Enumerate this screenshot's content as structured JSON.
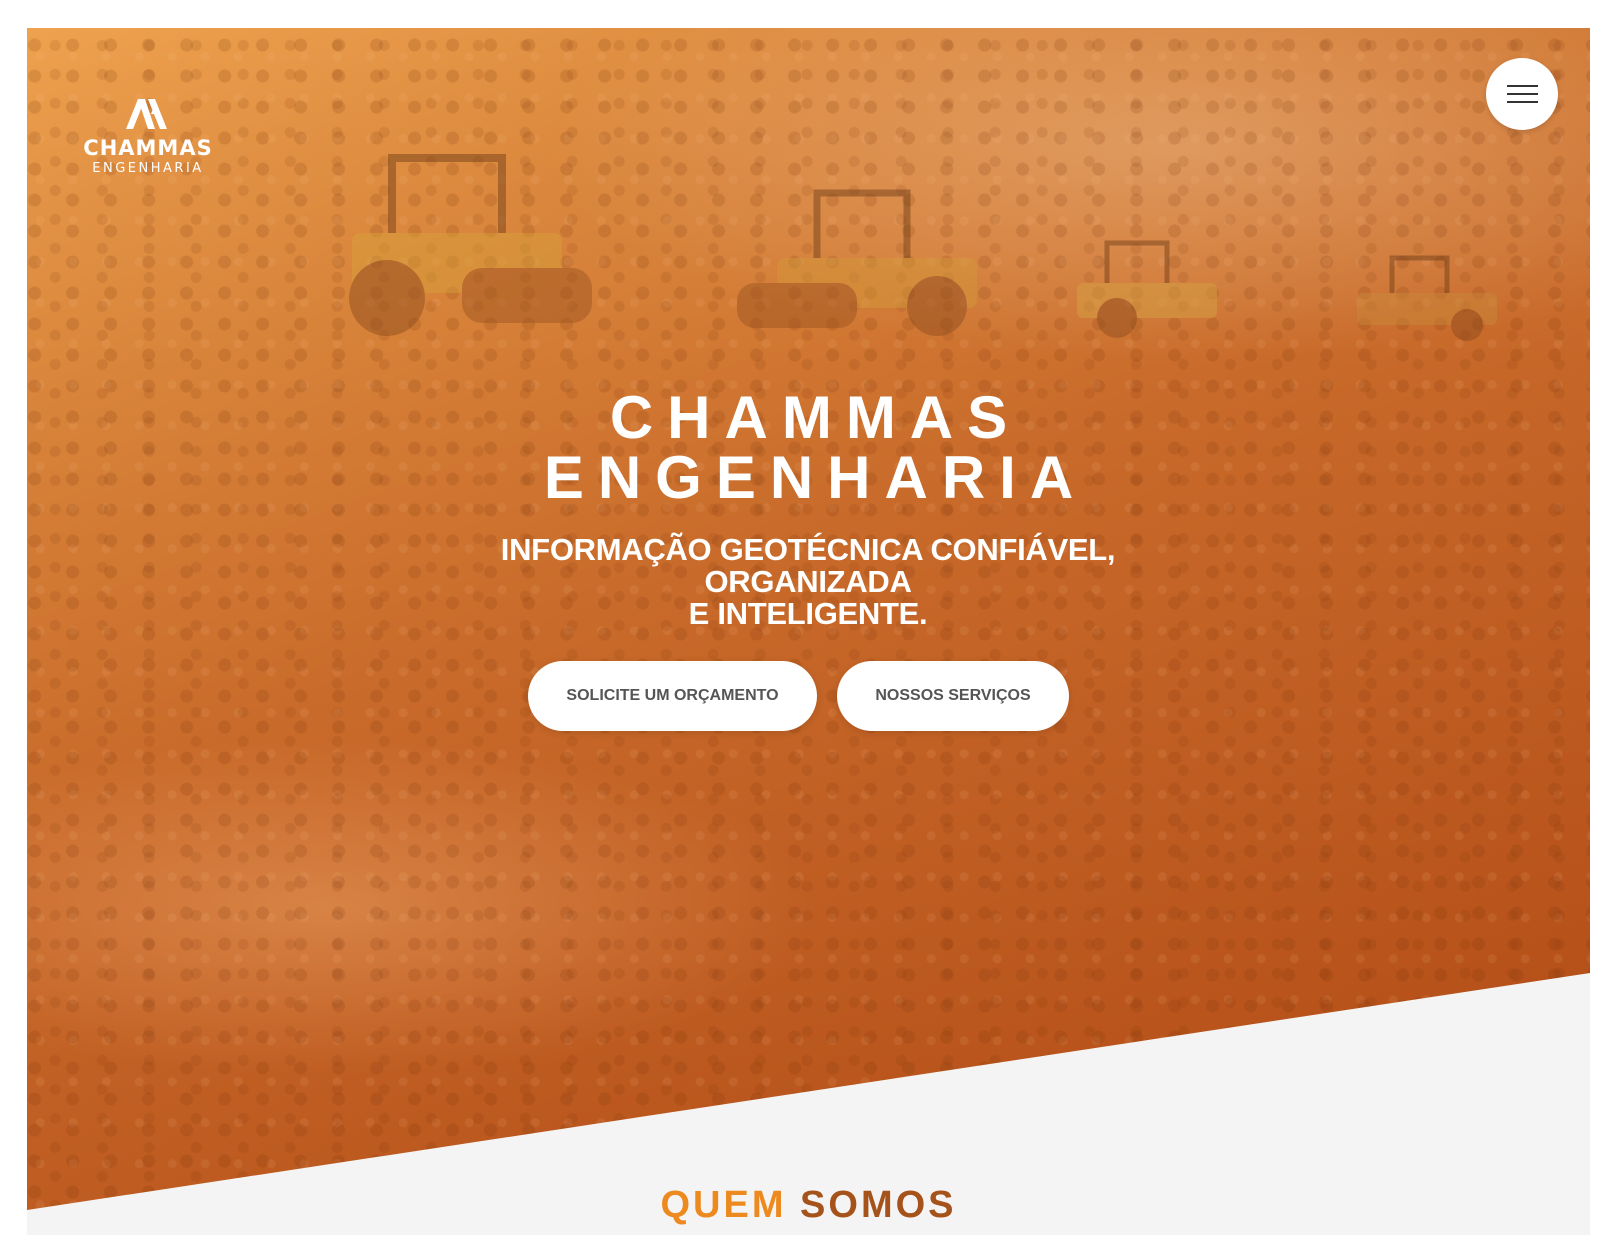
{
  "brand": {
    "logo_name": "CHAMMAS",
    "logo_sub": "ENGENHARIA",
    "logo_icon": "chammas-m-icon"
  },
  "header": {
    "menu_icon": "hamburger-menu-icon"
  },
  "hero": {
    "title_line1": "CHAMMAS",
    "title_line2": "ENGENHARIA",
    "subtitle_line1": "INFORMAÇÃO GEOTÉCNICA CONFIÁVEL, ORGANIZADA",
    "subtitle_line2": "E INTELIGENTE.",
    "buttons": {
      "quote": "SOLICITE UM ORÇAMENTO",
      "services": "NOSSOS SERVIÇOS"
    }
  },
  "about": {
    "title_word1": "QUEM",
    "title_word2": "SOMOS"
  },
  "colors": {
    "hero_orange": "#c86a2a",
    "accent_orange": "#ec8a1f",
    "accent_brown": "#a5531b",
    "button_text": "#555555",
    "background": "#f4f4f4"
  }
}
